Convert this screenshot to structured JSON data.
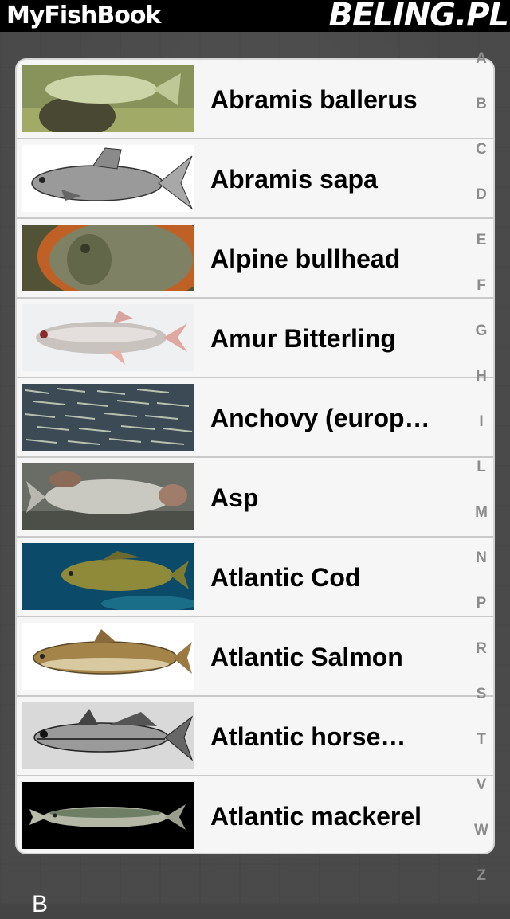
{
  "header": {
    "title": "MyFishBook",
    "brand": "BELING.PL"
  },
  "fish": [
    {
      "name": "Abramis ballerus",
      "thumb": "photo-greenish-fish"
    },
    {
      "name": "Abramis sapa",
      "thumb": "drawing-grey-bream"
    },
    {
      "name": "Alpine bullhead",
      "thumb": "photo-bullhead-in-bowl"
    },
    {
      "name": "Amur Bitterling",
      "thumb": "photo-silver-bitterling"
    },
    {
      "name": "Anchovy (europ…",
      "thumb": "photo-anchovy-school"
    },
    {
      "name": "Asp",
      "thumb": "photo-asp-held"
    },
    {
      "name": "Atlantic Cod",
      "thumb": "photo-cod-underwater"
    },
    {
      "name": "Atlantic Salmon",
      "thumb": "drawing-salmon"
    },
    {
      "name": "Atlantic horse…",
      "thumb": "drawing-horse-mackerel"
    },
    {
      "name": "Atlantic mackerel",
      "thumb": "photo-mackerel-black"
    }
  ],
  "index_letters": [
    "A",
    "B",
    "C",
    "D",
    "E",
    "F",
    "G",
    "H",
    "I",
    "L",
    "M",
    "N",
    "P",
    "R",
    "S",
    "T",
    "V",
    "W",
    "Z"
  ],
  "section_header_partial": "B",
  "colors": {
    "header_bg": "#000000",
    "panel_bg": "#f6f6f6",
    "separator": "#c9c9c9",
    "index_text": "#8c8c8c",
    "page_bg": "#4a4a4a"
  }
}
